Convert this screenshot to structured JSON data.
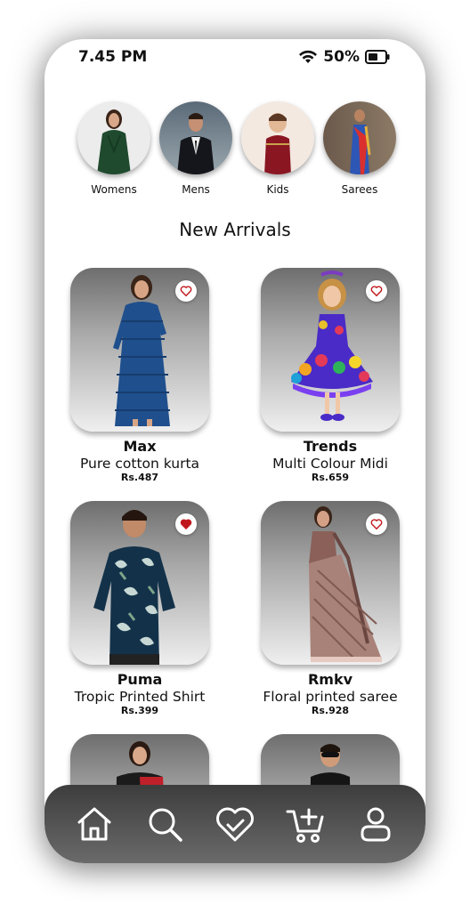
{
  "status": {
    "time": "7.45 PM",
    "battery": "50%"
  },
  "categories": [
    {
      "label": "Womens",
      "icon": "womens-category-photo"
    },
    {
      "label": "Mens",
      "icon": "mens-category-photo"
    },
    {
      "label": "Kids",
      "icon": "kids-category-photo"
    },
    {
      "label": "Sarees",
      "icon": "sarees-category-photo"
    }
  ],
  "section_title": "New Arrivals",
  "products": [
    {
      "brand": "Max",
      "name": "Pure cotton kurta",
      "price": "Rs.487",
      "favorited": false
    },
    {
      "brand": "Trends",
      "name": "Multi Colour Midi",
      "price": "Rs.659",
      "favorited": false
    },
    {
      "brand": "Puma",
      "name": "Tropic Printed Shirt",
      "price": "Rs.399",
      "favorited": true
    },
    {
      "brand": "Rmkv",
      "name": "Floral printed saree",
      "price": "Rs.928",
      "favorited": false
    }
  ],
  "nav": [
    "home-icon",
    "search-icon",
    "wishlist-icon",
    "add-to-cart-icon",
    "profile-icon"
  ],
  "colors": {
    "heart": "#c0171c",
    "nav_bg": "#4a4a4a"
  }
}
